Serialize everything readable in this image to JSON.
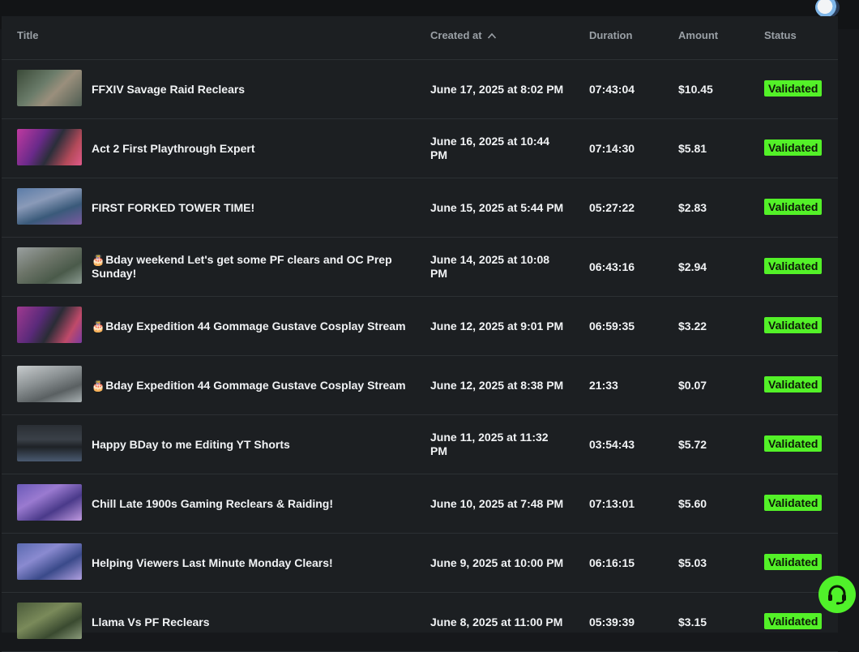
{
  "table": {
    "columns": {
      "title": "Title",
      "created": "Created at",
      "duration": "Duration",
      "amount": "Amount",
      "status": "Status"
    },
    "sort": {
      "column": "Created at",
      "direction": "ascending-arrow"
    },
    "rows": [
      {
        "title": "FFXIV Savage Raid Reclears",
        "created": "June 17, 2025 at 8:02 PM",
        "duration": "07:43:04",
        "amount": "$10.45",
        "status": "Validated",
        "cake": ""
      },
      {
        "title": "Act 2 First Playthrough Expert",
        "created": "June 16, 2025 at 10:44 PM",
        "duration": "07:14:30",
        "amount": "$5.81",
        "status": "Validated",
        "cake": ""
      },
      {
        "title": "FIRST FORKED TOWER TIME!",
        "created": "June 15, 2025 at 5:44 PM",
        "duration": "05:27:22",
        "amount": "$2.83",
        "status": "Validated",
        "cake": ""
      },
      {
        "title": "Bday weekend Let's get some PF clears and OC Prep Sunday!",
        "created": "June 14, 2025 at 10:08 PM",
        "duration": "06:43:16",
        "amount": "$2.94",
        "status": "Validated",
        "cake": "🎂"
      },
      {
        "title": "Bday Expedition 44 Gommage Gustave Cosplay Stream",
        "created": "June 12, 2025 at 9:01 PM",
        "duration": "06:59:35",
        "amount": "$3.22",
        "status": "Validated",
        "cake": "🎂"
      },
      {
        "title": "Bday Expedition 44 Gommage Gustave Cosplay Stream",
        "created": "June 12, 2025 at 8:38 PM",
        "duration": "21:33",
        "amount": "$0.07",
        "status": "Validated",
        "cake": "🎂"
      },
      {
        "title": "Happy BDay to me Editing YT Shorts",
        "created": "June 11, 2025 at 11:32 PM",
        "duration": "03:54:43",
        "amount": "$5.72",
        "status": "Validated",
        "cake": ""
      },
      {
        "title": "Chill Late 1900s Gaming Reclears & Raiding!",
        "created": "June 10, 2025 at 7:48 PM",
        "duration": "07:13:01",
        "amount": "$5.60",
        "status": "Validated",
        "cake": ""
      },
      {
        "title": "Helping Viewers Last Minute Monday Clears!",
        "created": "June 9, 2025 at 10:00 PM",
        "duration": "06:16:15",
        "amount": "$5.03",
        "status": "Validated",
        "cake": ""
      },
      {
        "title": "Llama Vs PF Reclears",
        "created": "June 8, 2025 at 11:00 PM",
        "duration": "05:39:39",
        "amount": "$3.15",
        "status": "Validated",
        "cake": ""
      }
    ]
  },
  "icons": {
    "sort": "chevron-up-icon",
    "help": "headset-icon",
    "avatar": "user-avatar"
  },
  "colors": {
    "accent": "#53f128",
    "background": "#1c1f22"
  }
}
